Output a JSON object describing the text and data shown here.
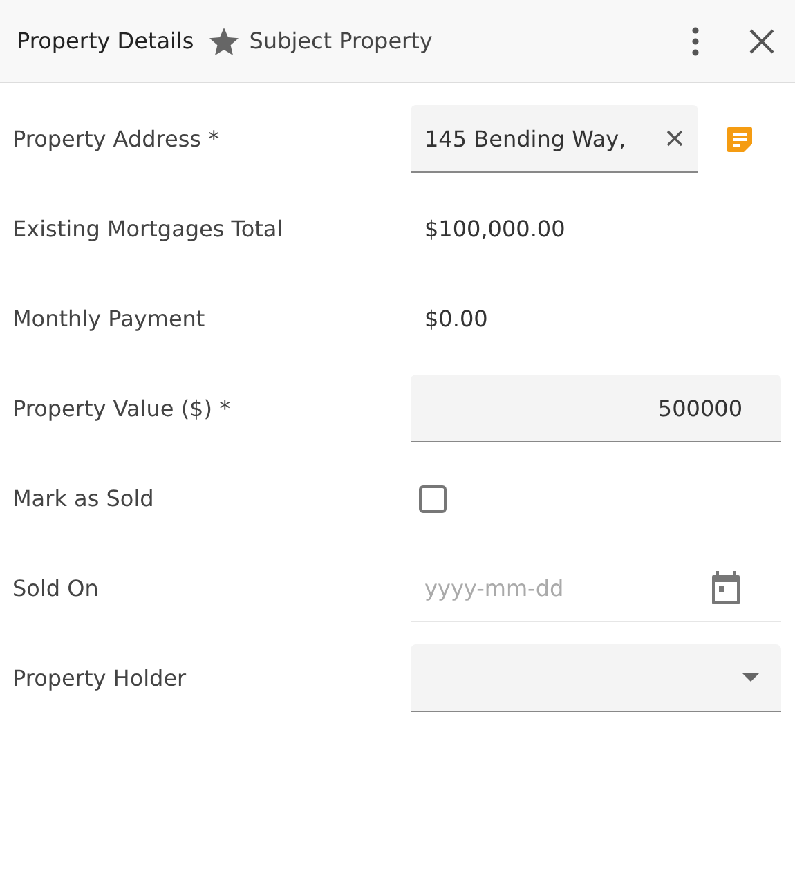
{
  "header": {
    "title": "Property Details",
    "subtitle": "Subject Property"
  },
  "fields": [
    {
      "kind": "text",
      "label": "Property Address *",
      "value": "145 Bending Way,"
    },
    {
      "kind": "static",
      "label": "Existing Mortgages Total",
      "value": "$100,000.00"
    },
    {
      "kind": "static",
      "label": "Monthly Payment",
      "value": "$0.00"
    },
    {
      "kind": "number",
      "label": "Property Value ($) *",
      "value": "500000"
    },
    {
      "kind": "checkbox",
      "label": "Mark as Sold",
      "checked": false
    },
    {
      "kind": "date",
      "label": "Sold On",
      "placeholder": "yyyy-mm-dd"
    },
    {
      "kind": "select",
      "label": "Property Holder"
    }
  ]
}
